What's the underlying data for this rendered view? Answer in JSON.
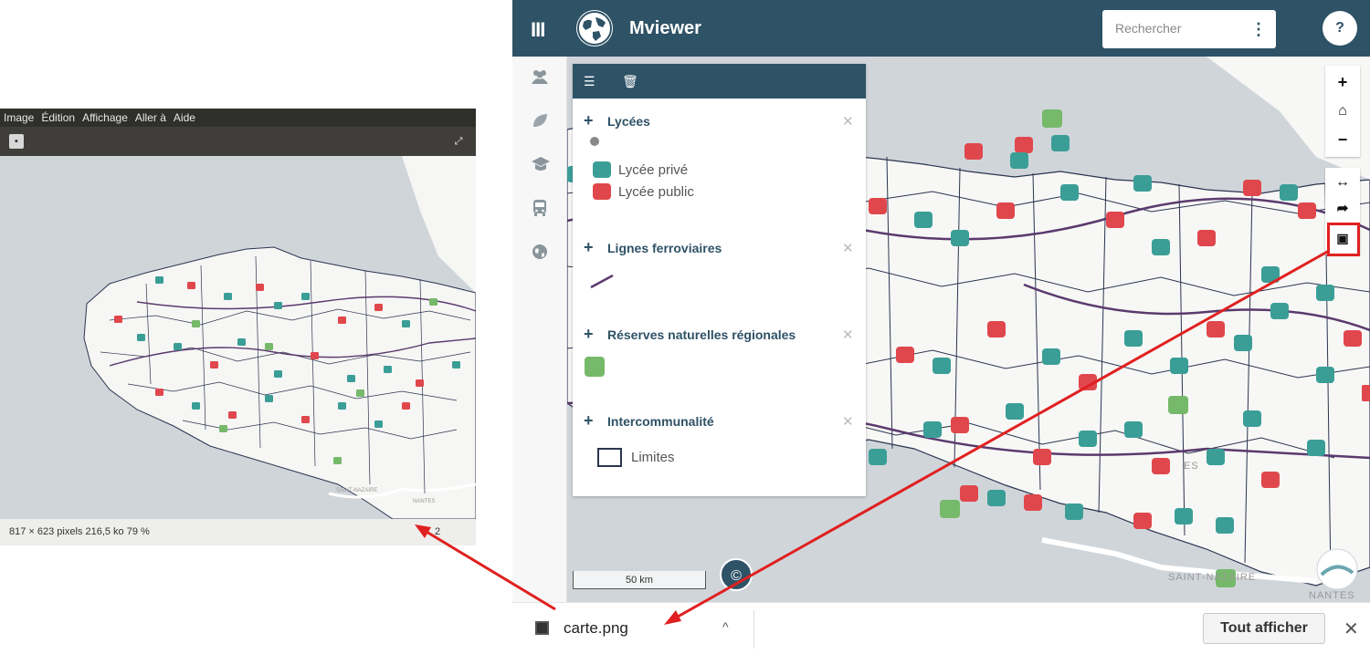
{
  "viewer": {
    "menu": [
      "Image",
      "Édition",
      "Affichage",
      "Aller à",
      "Aide"
    ],
    "status_info": "817 × 623 pixels  216,5 ko   79 %",
    "page_partial": "2",
    "map_labels": [
      "SAINT-NAZAIRE",
      "NANTES"
    ]
  },
  "app": {
    "title": "Mviewer",
    "search": {
      "placeholder": "Rechercher"
    },
    "help_label": "?",
    "menu_label": "III",
    "sidebar_icons": [
      "users-icon",
      "leaf-icon",
      "graduation-cap-icon",
      "bus-icon",
      "globe-icon"
    ],
    "legend": {
      "header_icons": [
        "list-icon",
        "trash-icon"
      ],
      "layers": [
        {
          "name": "Lycées",
          "items": [
            "Lycée privé",
            "Lycée public"
          ]
        },
        {
          "name": "Lignes ferroviaires"
        },
        {
          "name": "Réserves naturelles régionales"
        },
        {
          "name": "Intercommunalité",
          "items": [
            "Limites"
          ]
        }
      ]
    },
    "controls": {
      "zoom_in": "+",
      "home": "⌂",
      "zoom_out": "−",
      "measure": "↔",
      "share": "➦",
      "export_image": "▣"
    },
    "scale_label": "50 km",
    "attribution_label": "©",
    "map_labels": [
      "SAINT-NAZAIRE",
      "NANTES",
      "ES"
    ],
    "colors": {
      "header": "#2e5266",
      "lycee_prive": "#3a9e97",
      "lycee_public": "#e0474c",
      "reserve": "#76b96a",
      "highlight": "#e02020"
    }
  },
  "download": {
    "filename": "carte.png",
    "show_all": "Tout afficher",
    "close": "✕",
    "chevron": "^"
  }
}
